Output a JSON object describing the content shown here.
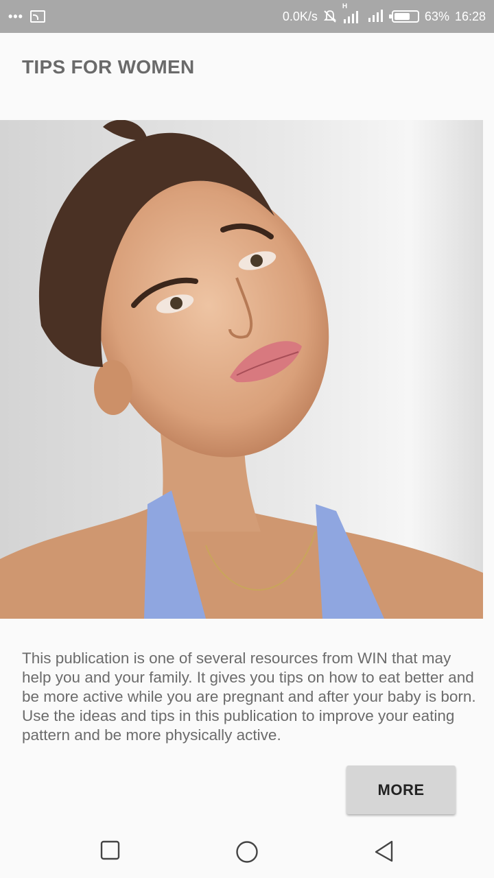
{
  "status_bar": {
    "network_speed": "0.0K/s",
    "network_type": "H",
    "battery": "63%",
    "time": "16:28",
    "icons": [
      "more-dots-icon",
      "cast-icon",
      "bell-off-icon",
      "signal-icon",
      "signal-icon",
      "battery-icon"
    ]
  },
  "header": {
    "title": "TIPS FOR WOMEN"
  },
  "hero": {
    "icon": "woman-portrait-photo"
  },
  "content": {
    "body": "This publication is one of several resources from WIN that may help you and your family. It gives you tips on how to eat better and be more active while you are pregnant and after your baby is born. Use the ideas and tips in this publication to improve your eating pattern and be more physically active."
  },
  "actions": {
    "more_label": "MORE"
  },
  "nav": {
    "icons": [
      "recents-square-icon",
      "home-circle-icon",
      "back-triangle-icon"
    ]
  },
  "colors": {
    "status_bar": "#a8a8a8",
    "background": "#fafafa",
    "title_text": "#6a6a6a",
    "body_text": "#6b6b6b",
    "button": "#d6d6d6"
  }
}
